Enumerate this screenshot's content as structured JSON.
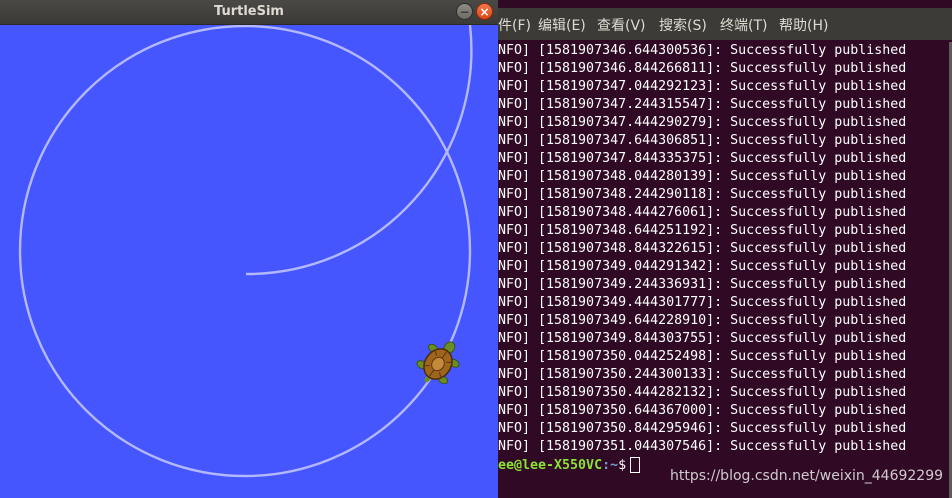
{
  "turtlesim": {
    "title": "TurtleSim",
    "minimize_glyph": "−",
    "close_glyph": "×",
    "background_color": "#4556ff",
    "pen_color": "#b3b8ff",
    "turtle_icon": "turtle-icon"
  },
  "terminal": {
    "menu": [
      "件(F)",
      "编辑(E)",
      "查看(V)",
      "搜索(S)",
      "终端(T)",
      "帮助(H)"
    ],
    "log_lines": [
      "NFO] [1581907346.644300536]: Successfully published",
      "NFO] [1581907346.844266811]: Successfully published",
      "NFO] [1581907347.044292123]: Successfully published",
      "NFO] [1581907347.244315547]: Successfully published",
      "NFO] [1581907347.444290279]: Successfully published",
      "NFO] [1581907347.644306851]: Successfully published",
      "NFO] [1581907347.844335375]: Successfully published",
      "NFO] [1581907348.044280139]: Successfully published",
      "NFO] [1581907348.244290118]: Successfully published",
      "NFO] [1581907348.444276061]: Successfully published",
      "NFO] [1581907348.644251192]: Successfully published",
      "NFO] [1581907348.844322615]: Successfully published",
      "NFO] [1581907349.044291342]: Successfully published",
      "NFO] [1581907349.244336931]: Successfully published",
      "NFO] [1581907349.444301777]: Successfully published",
      "NFO] [1581907349.644228910]: Successfully published",
      "NFO] [1581907349.844303755]: Successfully published",
      "NFO] [1581907350.044252498]: Successfully published",
      "NFO] [1581907350.244300133]: Successfully published",
      "NFO] [1581907350.444282132]: Successfully published",
      "NFO] [1581907350.644367000]: Successfully published",
      "NFO] [1581907350.844295946]: Successfully published",
      "NFO] [1581907351.044307546]: Successfully published"
    ],
    "prompt_user": "ee@lee-X550VC",
    "prompt_path": ":~",
    "prompt_symbol": "$"
  },
  "watermark": "https://blog.csdn.net/weixin_44692299"
}
